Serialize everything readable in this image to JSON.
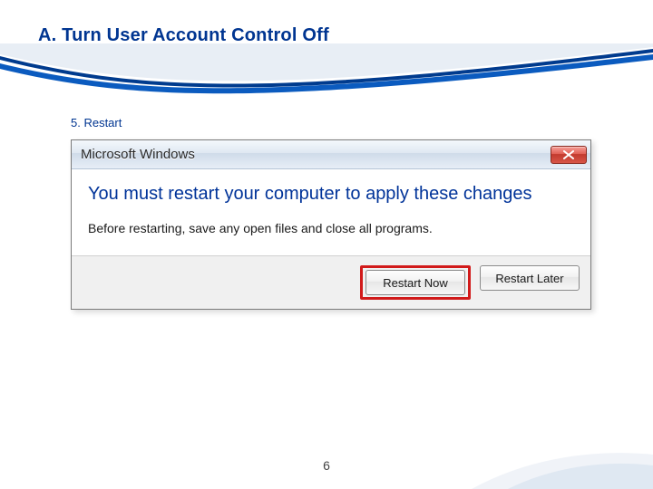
{
  "slide": {
    "title": "A. Turn User Account Control Off",
    "step_label": "5. Restart",
    "page_number": "6"
  },
  "dialog": {
    "window_title": "Microsoft Windows",
    "main_message": "You must restart your computer to apply these changes",
    "sub_message": "Before restarting, save any open files and close all programs.",
    "restart_now_label": "Restart Now",
    "restart_later_label": "Restart Later"
  }
}
